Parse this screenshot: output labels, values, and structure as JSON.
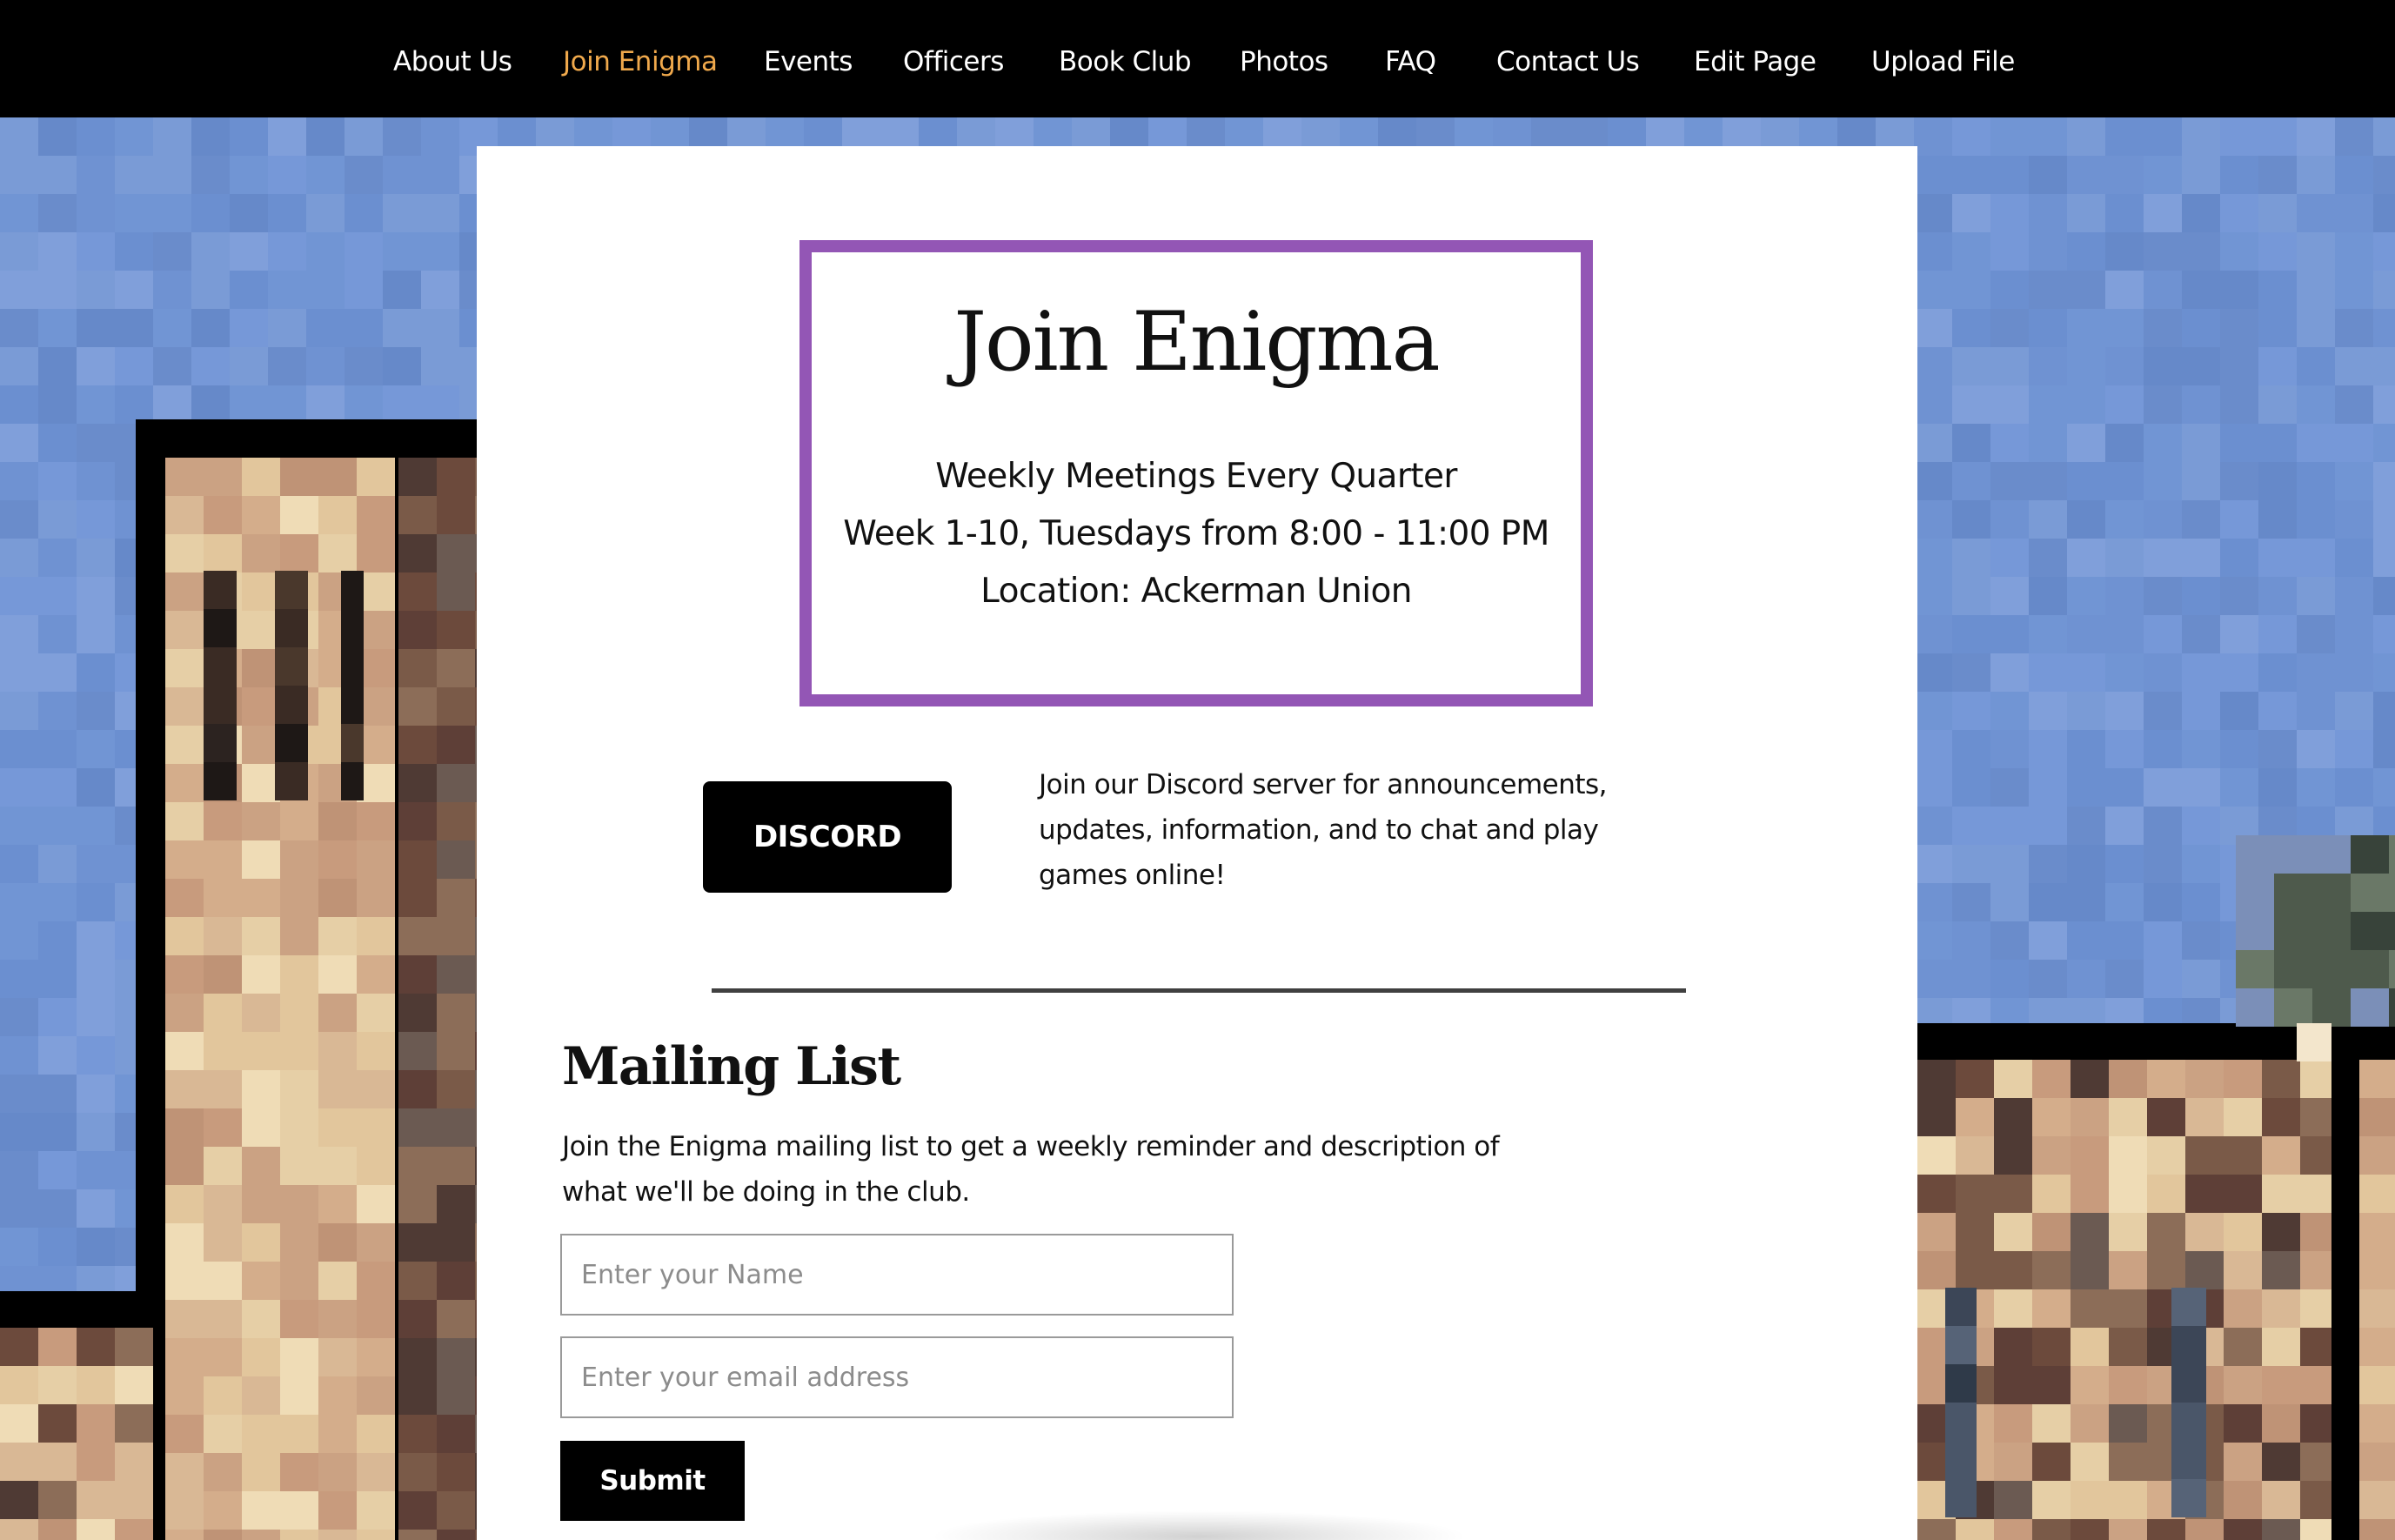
{
  "nav": {
    "items": [
      {
        "label": "About Us"
      },
      {
        "label": "Join Enigma",
        "active": true
      },
      {
        "label": "Events"
      },
      {
        "label": "Officers"
      },
      {
        "label": "Book Club"
      },
      {
        "label": "Photos"
      },
      {
        "label": "FAQ"
      },
      {
        "label": "Contact Us"
      },
      {
        "label": "Edit Page"
      },
      {
        "label": "Upload File"
      }
    ],
    "active_color": "#f0a94c"
  },
  "join": {
    "title": "Join Enigma",
    "lines": [
      "Weekly Meetings Every Quarter",
      "Week 1-10, Tuesdays from 8:00 - 11:00 PM",
      "Location: Ackerman Union"
    ],
    "border_color": "#9356b5"
  },
  "discord": {
    "button_label": "DISCORD",
    "description": "Join our Discord server for announcements, updates, information, and to chat and play games online!"
  },
  "mailing": {
    "title": "Mailing List",
    "description": "Join the Enigma mailing list to get a weekly reminder and description of what we'll be doing in the club.",
    "name_placeholder": "Enter your Name",
    "email_placeholder": "Enter your email address",
    "submit_label": "Submit"
  }
}
